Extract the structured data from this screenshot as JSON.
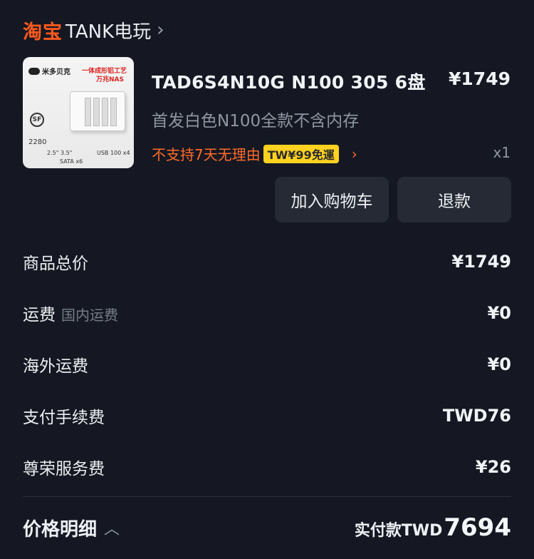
{
  "shop": {
    "logo_text": "淘宝",
    "name": "TANK电玩",
    "chevron": "›"
  },
  "product": {
    "title": "TAD6S4N10G N100 305 6盘",
    "price": "¥1749",
    "variant": "首发白色N100全款不含内存",
    "policy": "不支持7天无理由",
    "shipping_badge": "TW¥99免運",
    "policy_chevron": "›",
    "quantity": "x1",
    "thumbnail": {
      "brand": "米多贝克",
      "tag_line1": "一体成形铝工艺",
      "tag_line2": "万兆NAS",
      "sf_text": "SF",
      "spec1": "2280",
      "spec2": "2.5\" 3.5\"",
      "spec3": "SATA x6",
      "spec4": "USB 100 x4"
    }
  },
  "actions": {
    "add_to_cart": "加入购物车",
    "refund": "退款"
  },
  "summary": [
    {
      "label": "商品总价",
      "sub": "",
      "value": "¥1749"
    },
    {
      "label": "运费",
      "sub": "国内运费",
      "value": "¥0"
    },
    {
      "label": "海外运费",
      "sub": "",
      "value": "¥0"
    },
    {
      "label": "支付手续费",
      "sub": "",
      "value": "TWD76"
    },
    {
      "label": "尊荣服务费",
      "sub": "",
      "value": "¥26"
    }
  ],
  "footer": {
    "detail_label": "价格明细",
    "detail_chevron": "︿",
    "paid_label": "实付款TWD",
    "paid_value": "7694"
  },
  "colors": {
    "accent": "#ff5a1f",
    "badge": "#ffd21f",
    "background": "#151822"
  }
}
